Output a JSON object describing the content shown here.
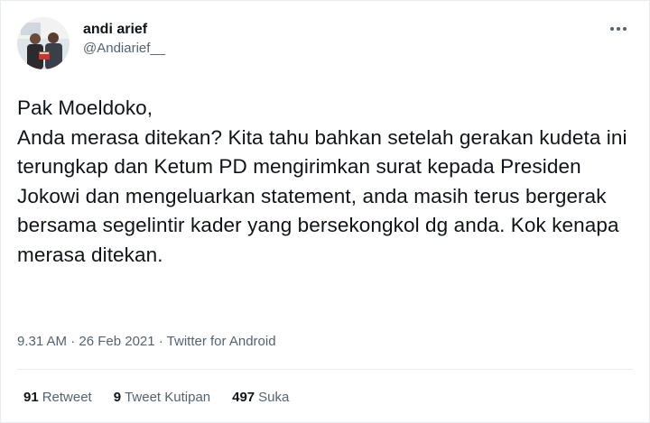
{
  "user": {
    "display_name": "andi arief",
    "handle": "@Andiarief__",
    "avatar_icon": "profile-photo"
  },
  "menu_icon": "more-horizontal-icon",
  "tweet": {
    "text": "Pak Moeldoko,\nAnda merasa ditekan? Kita tahu bahkan setelah gerakan kudeta ini terungkap dan Ketum PD mengirimkan surat kepada Presiden Jokowi dan mengeluarkan statement, anda masih terus bergerak bersama segelintir kader yang bersekongkol dg anda. Kok kenapa merasa ditekan.",
    "meta": "9.31 AM · 26 Feb 2021 · Twitter for Android"
  },
  "stats": {
    "retweets": {
      "count": "91",
      "label": "Retweet"
    },
    "quotes": {
      "count": "9",
      "label": "Tweet Kutipan"
    },
    "likes": {
      "count": "497",
      "label": "Suka"
    }
  },
  "colors": {
    "text": "#0f1419",
    "muted": "#536471",
    "border": "#e6ecf0"
  }
}
